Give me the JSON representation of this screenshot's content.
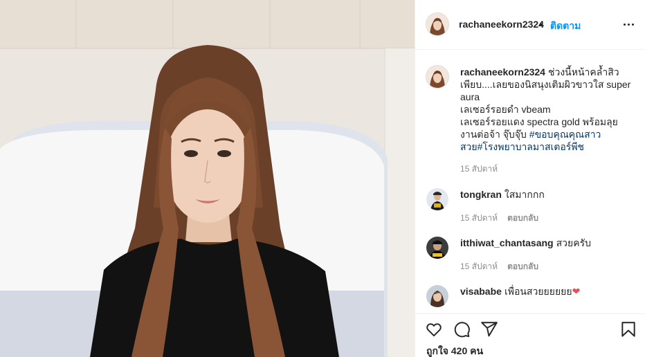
{
  "header": {
    "username": "rachaneekorn2324",
    "separator": "•",
    "follow_label": "ติดตาม",
    "more_icon": "more-horizontal-icon"
  },
  "caption": {
    "username": "rachaneekorn2324",
    "line1": "ช่วงนี้หน้าคล้ำสิว",
    "line2": "เพียบ....เลยของนิสนุงเติมผิวขาวใส super",
    "line3": "aura",
    "line4": "เลเซอร์รอยดำ vbeam",
    "line5": "เลเซอร์รอยแดง spectra gold พร้อมลุย",
    "line6": "งานต่อจ้า จุ๊บจุ๊บ",
    "hashtag1": "#ขอบคุณคุณสาว",
    "hashtag1b": "สวย",
    "hashtag2": "#โรงพยาบาลมาสเตอร์พีช",
    "time": "15 สัปดาห์"
  },
  "comments": [
    {
      "username": "tongkran",
      "text": "ใสมากกก",
      "time": "15 สัปดาห์",
      "reply_label": "ตอบกลับ"
    },
    {
      "username": "itthiwat_chantasang",
      "text": "สวยครับ",
      "time": "15 สัปดาห์",
      "reply_label": "ตอบกลับ"
    },
    {
      "username": "visababe",
      "text": "เพื่อนสวยยยยยย",
      "emoji": "❤"
    }
  ],
  "footer": {
    "likes": "ถูกใจ 420 คน",
    "icons": [
      "heart-icon",
      "comment-icon",
      "share-icon",
      "bookmark-icon"
    ]
  },
  "colors": {
    "link": "#0095f6",
    "hashtag": "#00376b",
    "muted": "#8e8e8e",
    "text": "#262626",
    "heart": "#ed4956"
  }
}
